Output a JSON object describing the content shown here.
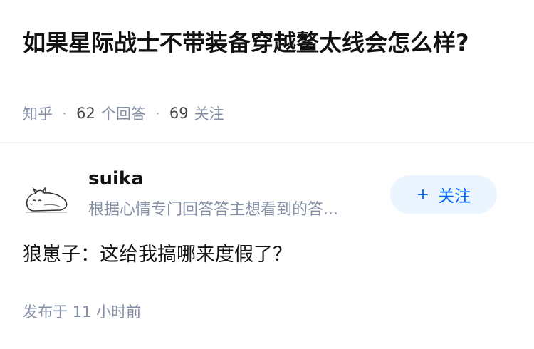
{
  "question": {
    "title": "如果星际战士不带装备穿越鳌太线会怎么样?"
  },
  "meta": {
    "source": "知乎",
    "answers_count": "62",
    "answers_label": "个回答",
    "followers_count": "69",
    "followers_label": "关注"
  },
  "author": {
    "name": "suika",
    "bio": "根据心情专门回答答主想看到的答...",
    "avatar_icon": "sketch-cat-avatar-icon"
  },
  "follow_button": {
    "plus": "+",
    "label": "关注"
  },
  "answer": {
    "content": "狼崽子：这给我搞哪来度假了？",
    "published_label": "发布于",
    "published_time": "11 小时前"
  },
  "colors": {
    "accent": "#0066ff",
    "accent_bg": "#ebf5ff",
    "muted": "#8590a6"
  }
}
